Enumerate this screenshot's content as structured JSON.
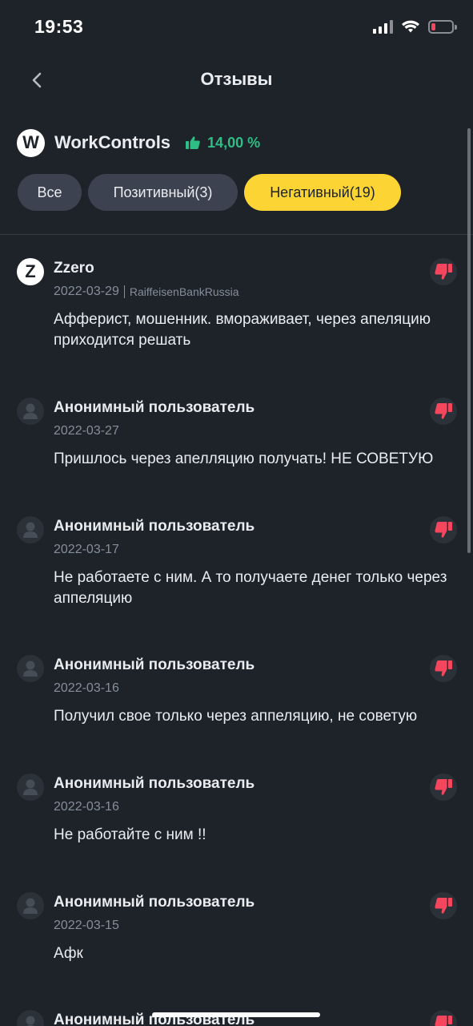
{
  "status_bar": {
    "time": "19:53"
  },
  "header": {
    "title": "Отзывы"
  },
  "merchant": {
    "avatar_letter": "W",
    "name": "WorkControls",
    "rating": "14,00 %"
  },
  "tabs": [
    {
      "label": "Все",
      "active": false
    },
    {
      "label": "Позитивный(3)",
      "active": false
    },
    {
      "label": "Негативный(19)",
      "active": true
    }
  ],
  "reviews": [
    {
      "avatar_letter": "Z",
      "name": "Zzero",
      "date": "2022-03-29",
      "bank": "RaiffeisenBankRussia",
      "text": "Афферист, мошенник. вмораживает, через апеляцию приходится решать"
    },
    {
      "name": "Анонимный пользователь",
      "date": "2022-03-27",
      "text": "Пришлось через апелляцию получать! НЕ СОВЕТУЮ"
    },
    {
      "name": "Анонимный пользователь",
      "date": "2022-03-17",
      "text": "Не работаете с ним. А то получаете денег только через аппеляцию"
    },
    {
      "name": "Анонимный пользователь",
      "date": "2022-03-16",
      "text": "Получил свое только через аппеляцию, не советую"
    },
    {
      "name": "Анонимный пользователь",
      "date": "2022-03-16",
      "text": "Не работайте с ним !!"
    },
    {
      "name": "Анонимный пользователь",
      "date": "2022-03-15",
      "text": "Афк"
    },
    {
      "name": "Анонимный пользователь"
    }
  ],
  "icons": {
    "back": "chevron-left-icon",
    "rating": "thumbs-up-icon",
    "review_type": "thumbs-down-icon",
    "anonymous_avatar": "user-icon"
  },
  "colors": {
    "background": "#1e2329",
    "accent": "#fcd535",
    "positive": "#2ebd85",
    "negative": "#f6465d"
  }
}
